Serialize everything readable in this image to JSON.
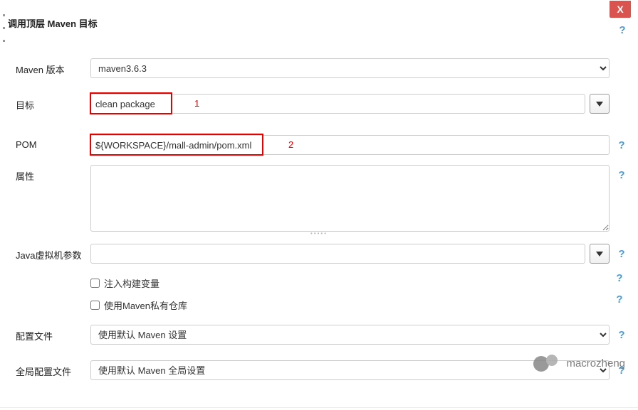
{
  "header": {
    "title": "调用顶层 Maven 目标"
  },
  "fields": {
    "maven_version": {
      "label": "Maven 版本",
      "value": "maven3.6.3"
    },
    "goal": {
      "label": "目标",
      "value": "clean package",
      "annotation": "1"
    },
    "pom": {
      "label": "POM",
      "value": "${WORKSPACE}/mall-admin/pom.xml",
      "annotation": "2"
    },
    "properties": {
      "label": "属性",
      "value": ""
    },
    "jvm_opts": {
      "label": "Java虚拟机参数",
      "value": ""
    },
    "inject_vars": {
      "label": "注入构建变量"
    },
    "private_repo": {
      "label": "使用Maven私有仓库"
    },
    "settings": {
      "label": "配置文件",
      "value": "使用默认 Maven 设置"
    },
    "global_settings": {
      "label": "全局配置文件",
      "value": "使用默认 Maven 全局设置"
    }
  },
  "watermark": "macrozheng"
}
